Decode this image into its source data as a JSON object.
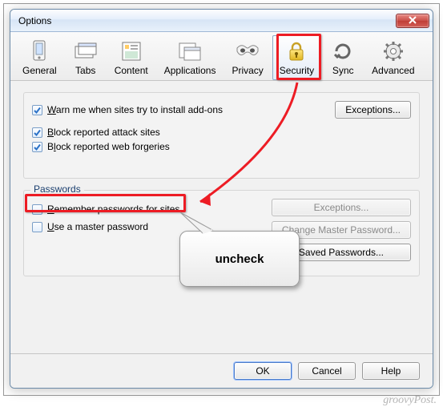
{
  "window": {
    "title": "Options"
  },
  "tabs": [
    {
      "id": "general",
      "label": "General"
    },
    {
      "id": "tabs",
      "label": "Tabs"
    },
    {
      "id": "content",
      "label": "Content"
    },
    {
      "id": "applications",
      "label": "Applications"
    },
    {
      "id": "privacy",
      "label": "Privacy"
    },
    {
      "id": "security",
      "label": "Security",
      "selected": true
    },
    {
      "id": "sync",
      "label": "Sync"
    },
    {
      "id": "advanced",
      "label": "Advanced"
    }
  ],
  "security": {
    "warn_addons": {
      "label_pre": "",
      "label_u": "W",
      "label_post": "arn me when sites try to install add-ons",
      "checked": true
    },
    "block_attack": {
      "label_pre": "",
      "label_u": "B",
      "label_post": "lock reported attack sites",
      "checked": true
    },
    "block_forgeries": {
      "label_pre": "B",
      "label_u": "l",
      "label_post": "ock reported web forgeries",
      "checked": true
    },
    "exceptions_label": "Exceptions..."
  },
  "passwords": {
    "section_title": "Passwords",
    "remember": {
      "label_pre": "",
      "label_u": "R",
      "label_post": "emember passwords for sites",
      "checked": false
    },
    "master": {
      "label_pre": "",
      "label_u": "U",
      "label_post": "se a master password",
      "checked": false
    },
    "exceptions_label": "Exceptions...",
    "change_master_label_pre": "Change ",
    "change_master_label_u": "M",
    "change_master_label_post": "aster Password...",
    "saved_label_pre": "Saved ",
    "saved_label_u": "P",
    "saved_label_post": "asswords..."
  },
  "footer": {
    "ok": "OK",
    "cancel": "Cancel",
    "help_u": "H",
    "help_post": "elp"
  },
  "annotation": {
    "callout_text": "uncheck"
  },
  "watermark": "groovyPost."
}
